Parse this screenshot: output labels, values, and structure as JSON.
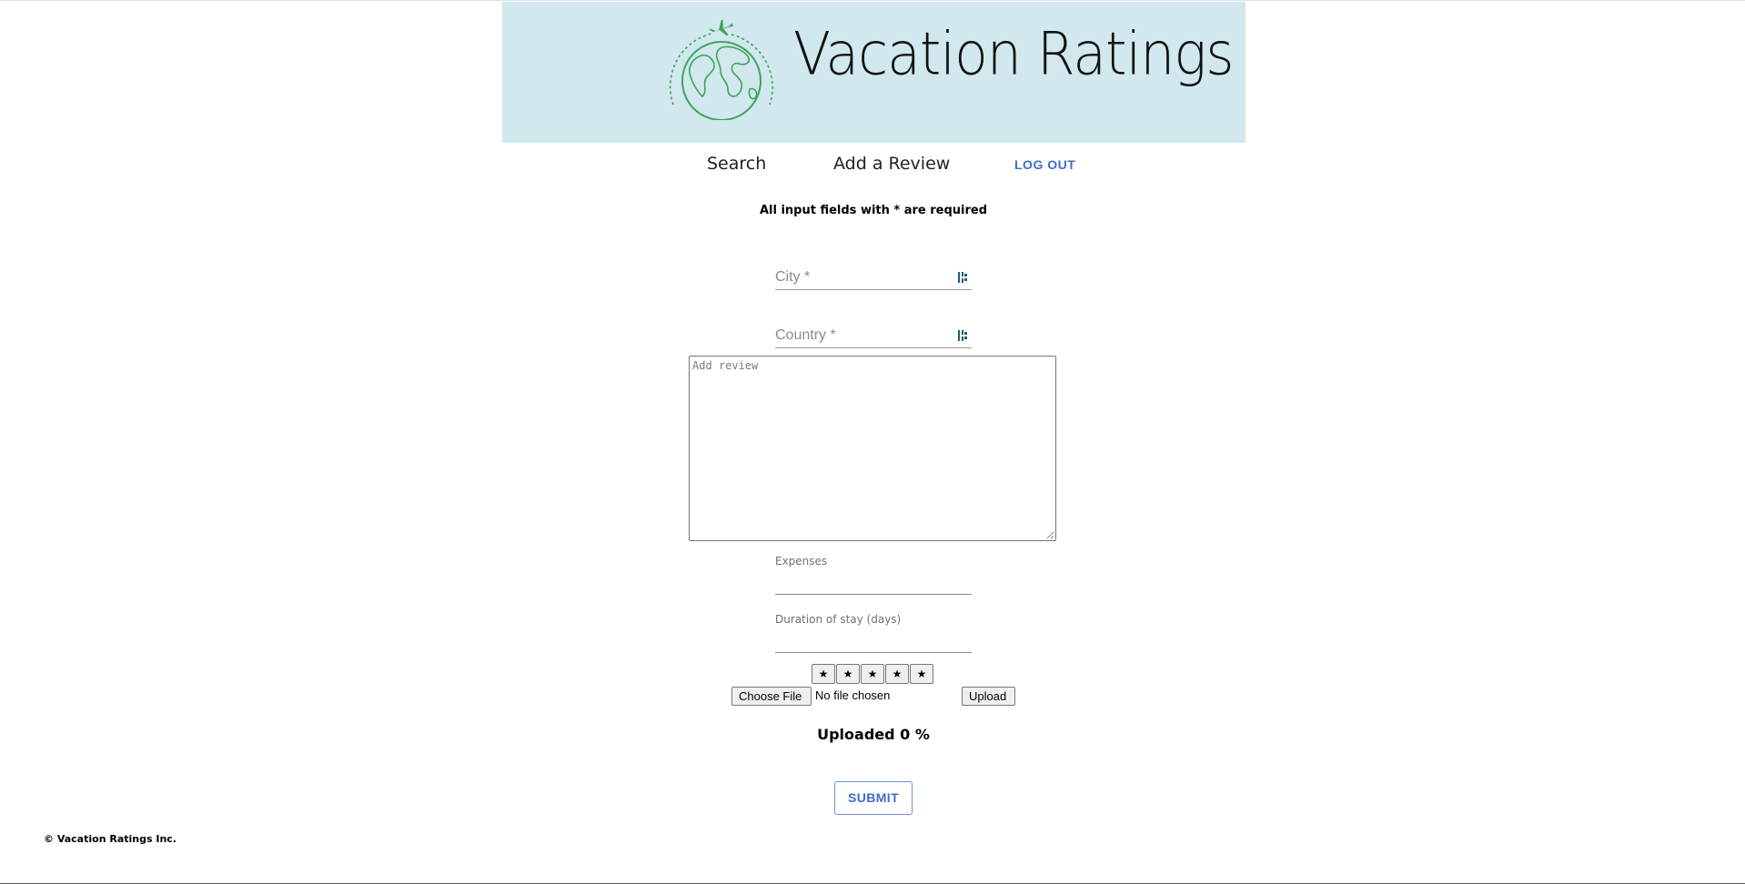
{
  "header": {
    "title": "Vacation Ratings",
    "banner_color": "#d0e8ee",
    "logo_icon": "globe-airplane-icon"
  },
  "nav": {
    "search": "Search",
    "add_review": "Add a Review",
    "logout": "LOG OUT",
    "accent_color": "#3f6fc4"
  },
  "form": {
    "required_note": "All input fields with * are required",
    "city": {
      "label": "City *",
      "value": "",
      "icon": "password-manager-icon"
    },
    "country": {
      "label": "Country *",
      "value": "",
      "icon": "password-manager-icon"
    },
    "review": {
      "placeholder": "Add review",
      "value": ""
    },
    "expenses": {
      "label": "Expenses",
      "value": ""
    },
    "duration": {
      "label": "Duration of stay (days)",
      "value": ""
    },
    "rating": {
      "stars": [
        "★",
        "★",
        "★",
        "★",
        "★"
      ],
      "selected": 0
    },
    "file": {
      "choose_label": "Choose File",
      "status": "No file chosen",
      "upload_label": "Upload"
    },
    "progress": {
      "label": "Uploaded",
      "percent": 0,
      "unit": "%"
    },
    "submit_label": "SUBMIT"
  },
  "footer": {
    "copyright": "© Vacation Ratings Inc."
  }
}
